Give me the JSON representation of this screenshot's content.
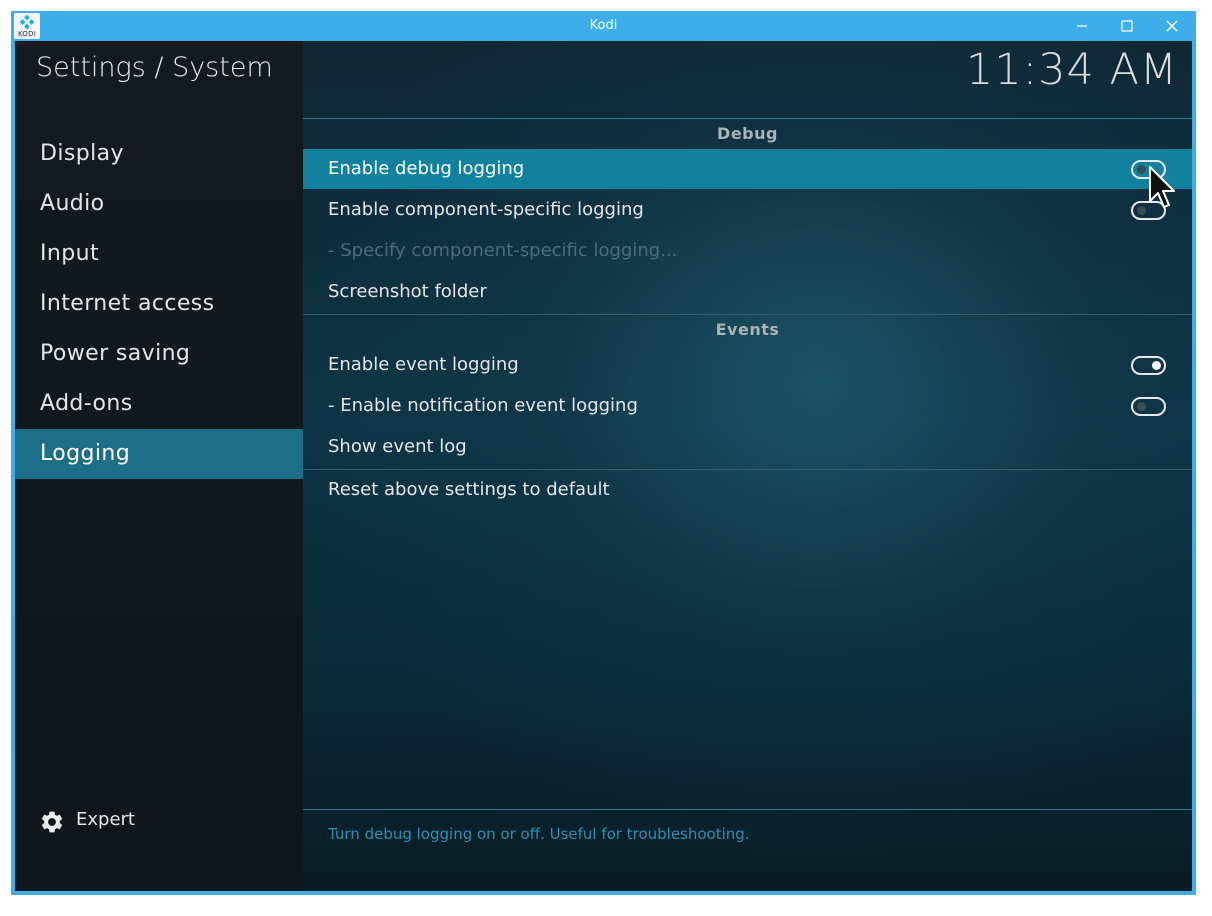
{
  "window": {
    "title": "Kodi",
    "app_icon": "kodi-logo-icon",
    "app_icon_label": "KODI",
    "controls": [
      "minimize-icon",
      "maximize-icon",
      "close-icon"
    ]
  },
  "colors": {
    "titlebar": "#3daee9",
    "focused_row": "#11819e",
    "active_nav": "#1d6e88",
    "help_text": "#2c8fb3"
  },
  "sidebar": {
    "title": "Settings / System",
    "items": [
      {
        "label": "Display"
      },
      {
        "label": "Audio"
      },
      {
        "label": "Input"
      },
      {
        "label": "Internet access"
      },
      {
        "label": "Power saving"
      },
      {
        "label": "Add-ons"
      },
      {
        "label": "Logging",
        "active": true
      }
    ],
    "expert_label": "Expert",
    "expert_icon": "gear-icon"
  },
  "header": {
    "clock": "11:34 AM"
  },
  "sections": [
    {
      "title": "Debug",
      "rows": [
        {
          "label": "Enable debug logging",
          "toggle": "off",
          "focused": true
        },
        {
          "label": "Enable component-specific logging",
          "toggle": "off"
        },
        {
          "label": "- Specify component-specific logging...",
          "disabled": true
        },
        {
          "label": "Screenshot folder"
        }
      ]
    },
    {
      "title": "Events",
      "rows": [
        {
          "label": "Enable event logging",
          "toggle": "on"
        },
        {
          "label": "- Enable notification event logging",
          "toggle": "off"
        },
        {
          "label": "Show event log"
        }
      ]
    }
  ],
  "reset_label": "Reset above settings to default",
  "help_text": "Turn debug logging on or off. Useful for troubleshooting."
}
